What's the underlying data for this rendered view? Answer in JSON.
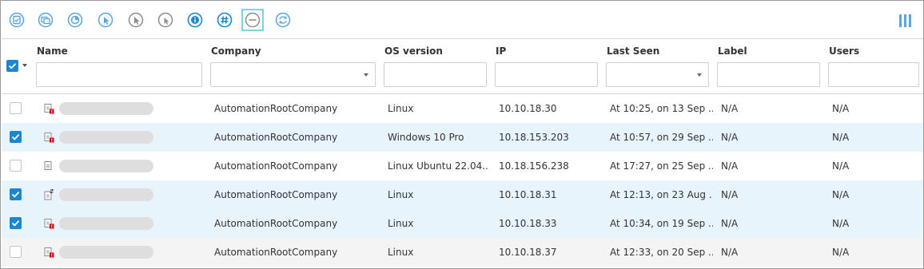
{
  "toolbar": {
    "icons": [
      {
        "name": "tasks-icon"
      },
      {
        "name": "reports-icon"
      },
      {
        "name": "chart-pie-icon"
      },
      {
        "name": "cursor-select-icon"
      },
      {
        "name": "cursor-multi-icon"
      },
      {
        "name": "cursor-arrow-icon"
      },
      {
        "name": "info-icon"
      },
      {
        "name": "hashtag-icon"
      },
      {
        "name": "minus-circle-icon"
      },
      {
        "name": "refresh-icon"
      }
    ],
    "active_icon": "minus-circle-icon",
    "columns_icon": "columns-icon"
  },
  "table": {
    "columns": {
      "name": "Name",
      "company": "Company",
      "os": "OS version",
      "ip": "IP",
      "last_seen": "Last Seen",
      "label": "Label",
      "users": "Users"
    },
    "rows": [
      {
        "checked": false,
        "company": "AutomationRootCompany",
        "os": "Linux",
        "ip": "10.10.18.30",
        "last_seen": "At 10:25, on 13 Sep ...",
        "label": "N/A",
        "users": "N/A",
        "icon": "device-alert-icon",
        "state": "normal"
      },
      {
        "checked": true,
        "company": "AutomationRootCompany",
        "os": "Windows 10 Pro",
        "ip": "10.18.153.203",
        "last_seen": "At 10:57, on 29 Sep ...",
        "label": "N/A",
        "users": "N/A",
        "icon": "device-alert-icon",
        "state": "selected"
      },
      {
        "checked": false,
        "company": "AutomationRootCompany",
        "os": "Linux Ubuntu 22.04....",
        "ip": "10.18.156.238",
        "last_seen": "At 17:27, on 25 Sep ...",
        "label": "N/A",
        "users": "N/A",
        "icon": "device-icon",
        "state": "normal"
      },
      {
        "checked": true,
        "company": "AutomationRootCompany",
        "os": "Linux",
        "ip": "10.10.18.31",
        "last_seen": "At 12:13, on 23 Aug ...",
        "label": "N/A",
        "users": "N/A",
        "icon": "device-sync-icon",
        "state": "selected"
      },
      {
        "checked": true,
        "company": "AutomationRootCompany",
        "os": "Linux",
        "ip": "10.10.18.33",
        "last_seen": "At 10:34, on 19 Sep ...",
        "label": "N/A",
        "users": "N/A",
        "icon": "device-alert-icon",
        "state": "selected"
      },
      {
        "checked": false,
        "company": "AutomationRootCompany",
        "os": "Linux",
        "ip": "10.10.18.37",
        "last_seen": "At 12:33, on 20 Sep ...",
        "label": "N/A",
        "users": "N/A",
        "icon": "device-alert-icon",
        "state": "hover"
      }
    ]
  },
  "colors": {
    "accent": "#1d86d0",
    "icon_blue": "#5aa6dc",
    "active_outline": "#7fd3db",
    "selected_row": "#e8f4fb",
    "hover_row": "#f4f4f4",
    "alert_red": "#d0021b"
  }
}
